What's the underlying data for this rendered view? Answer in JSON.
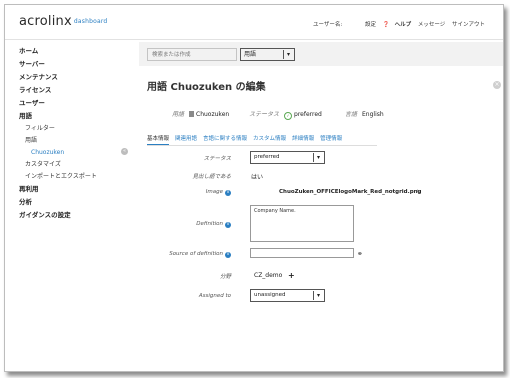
{
  "header": {
    "logo_text": "acrolinx",
    "logo_sub": "dashboard",
    "user_label": "ユーザー名:",
    "nav": [
      "設定",
      "ヘルプ",
      "メッセージ",
      "サインアウト"
    ]
  },
  "sidebar": {
    "items": [
      {
        "label": "ホーム",
        "level": 0
      },
      {
        "label": "サーバー",
        "level": 0
      },
      {
        "label": "メンテナンス",
        "level": 0
      },
      {
        "label": "ライセンス",
        "level": 0
      },
      {
        "label": "ユーザー",
        "level": 0
      },
      {
        "label": "用語",
        "level": 0
      },
      {
        "label": "フィルター",
        "level": 1
      },
      {
        "label": "用語",
        "level": 1
      },
      {
        "label": "Chuozuken",
        "level": 2
      },
      {
        "label": "カスタマイズ",
        "level": 1
      },
      {
        "label": "インポートとエクスポート",
        "level": 1
      },
      {
        "label": "再利用",
        "level": 0
      },
      {
        "label": "分析",
        "level": 0
      },
      {
        "label": "ガイダンスの設定",
        "level": 0
      }
    ]
  },
  "search": {
    "placeholder": "検索または作成",
    "scope_value": "用語"
  },
  "page": {
    "title": "用語 Chuozuken の編集",
    "term_label": "用語",
    "term_value": "Chuozuken",
    "status_label": "ステータス",
    "status_value": "preferred",
    "language_label": "言語",
    "language_value": "English"
  },
  "tabs": [
    "基本情報",
    "関連用語",
    "言語に関する情報",
    "カスタム情報",
    "詳細情報",
    "管理情報"
  ],
  "form": {
    "status_label": "ステータス",
    "status_value": "preferred",
    "headword_label": "見出し語である",
    "headword_value": "はい",
    "image_label": "Image",
    "image_value": "ChuoZuken_OFFICElogoMark_Red_notgrid.png",
    "definition_label": "Definition",
    "definition_value": "Company Name.",
    "source_label": "Source of definition",
    "source_value": "",
    "domain_label": "分野",
    "domain_value": "CZ_demo",
    "assigned_label": "Assigned to",
    "assigned_value": "unassigned"
  },
  "colors": {
    "accent": "#2b7fc2",
    "status_ok": "#5aa852"
  }
}
